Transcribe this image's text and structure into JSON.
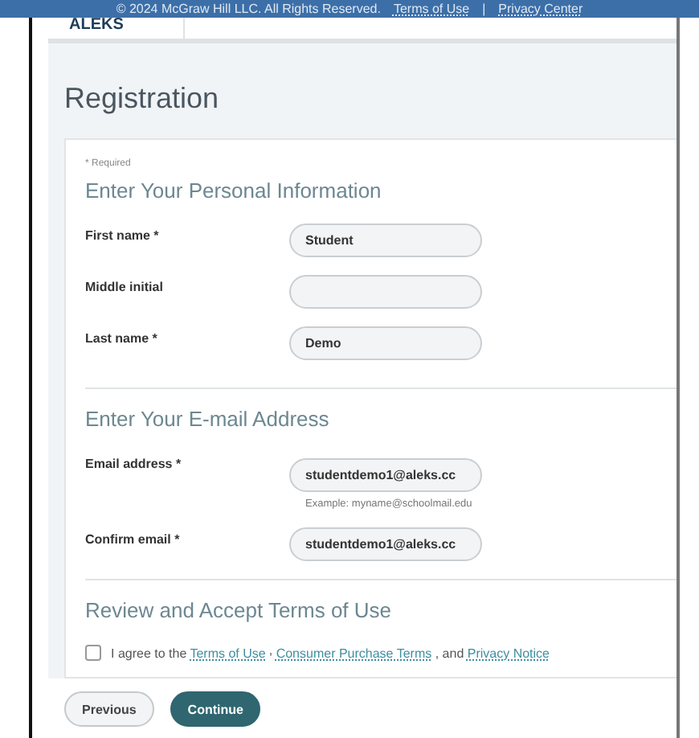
{
  "top_strip": {
    "copyright": "© 2024 McGraw Hill LLC. All Rights Reserved.",
    "links": [
      "Terms of Use",
      "Privacy Center"
    ],
    "separator": "|"
  },
  "logo": "ALEKS",
  "page_title": "Registration",
  "required_note": "* Required",
  "sections": [
    {
      "heading": "Enter Your Personal Information",
      "fields": [
        {
          "label": "First name *",
          "value": "Student"
        },
        {
          "label": "Middle initial"
        },
        {
          "label": "Last name *",
          "value": "Demo"
        }
      ]
    },
    {
      "heading": "Enter Your E-mail Address",
      "fields": [
        {
          "label": "Email address *",
          "value": "studentdemo1@aleks.cc",
          "hint": "Example: myname@schoolmail.edu"
        },
        {
          "label": "Confirm email *",
          "value": "studentdemo1@aleks.cc"
        }
      ]
    },
    {
      "heading": "Review and Accept Terms of Use",
      "agreement": {
        "checked": false,
        "parts": [
          {
            "kind": "text",
            "text": "I agree to the"
          },
          {
            "kind": "link",
            "text": "Terms of Use"
          },
          {
            "kind": "punct",
            "text": ","
          },
          {
            "kind": "link",
            "text": "Consumer Purchase Terms"
          },
          {
            "kind": "text",
            "text": ", and"
          },
          {
            "kind": "link",
            "text": "Privacy Notice"
          }
        ]
      }
    }
  ],
  "buttons": [
    {
      "label": "Previous",
      "kind": "secondary"
    },
    {
      "label": "Continue",
      "kind": "primary"
    }
  ]
}
